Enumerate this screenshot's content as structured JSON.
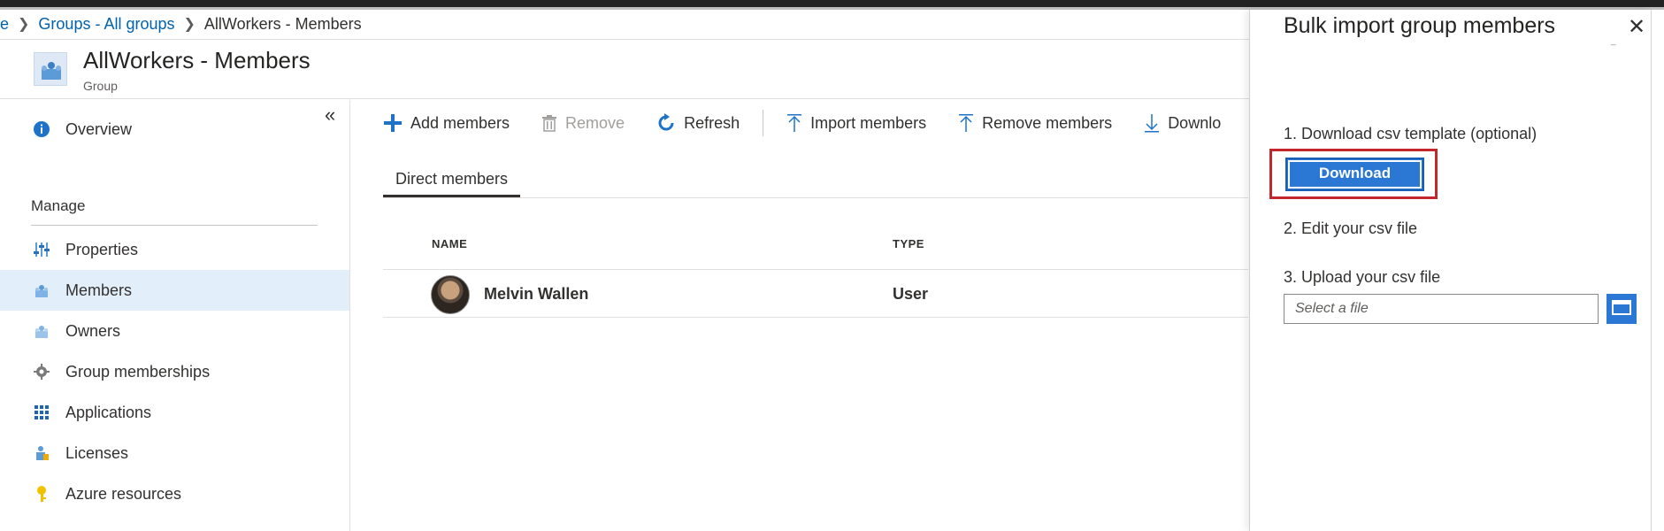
{
  "breadcrumb": {
    "partial_first": "e",
    "items": [
      "Groups - All groups"
    ],
    "current": "AllWorkers - Members"
  },
  "header": {
    "title": "AllWorkers - Members",
    "subtitle": "Group"
  },
  "sidebar": {
    "collapse_label": "«",
    "manage_label": "Manage",
    "items": [
      {
        "label": "Overview",
        "icon": "info-icon"
      },
      {
        "label": "Properties",
        "icon": "properties-icon"
      },
      {
        "label": "Members",
        "icon": "members-icon",
        "active": true
      },
      {
        "label": "Owners",
        "icon": "owners-icon"
      },
      {
        "label": "Group memberships",
        "icon": "gear-icon"
      },
      {
        "label": "Applications",
        "icon": "grid-icon"
      },
      {
        "label": "Licenses",
        "icon": "licenses-icon"
      },
      {
        "label": "Azure resources",
        "icon": "key-icon"
      }
    ]
  },
  "toolbar": {
    "add_members": "Add members",
    "remove": "Remove",
    "refresh": "Refresh",
    "import_members": "Import members",
    "remove_members": "Remove members",
    "download_partial": "Downlo"
  },
  "tabs": [
    "Direct members"
  ],
  "table": {
    "columns": [
      "NAME",
      "TYPE"
    ],
    "rows": [
      {
        "name": "Melvin Wallen",
        "type": "User"
      }
    ]
  },
  "panel": {
    "title": "Bulk import group members",
    "close_label": "✕",
    "tiny_mark": "_",
    "step1": "1. Download csv template (optional)",
    "download_button": "Download",
    "step2": "2. Edit your csv file",
    "step3": "3. Upload your csv file",
    "file_placeholder": "Select a file"
  },
  "colors": {
    "accent": "#0078d4",
    "button_blue": "#2b77d4",
    "highlight_red": "#c4262e",
    "active_nav": "#e3eefb"
  }
}
